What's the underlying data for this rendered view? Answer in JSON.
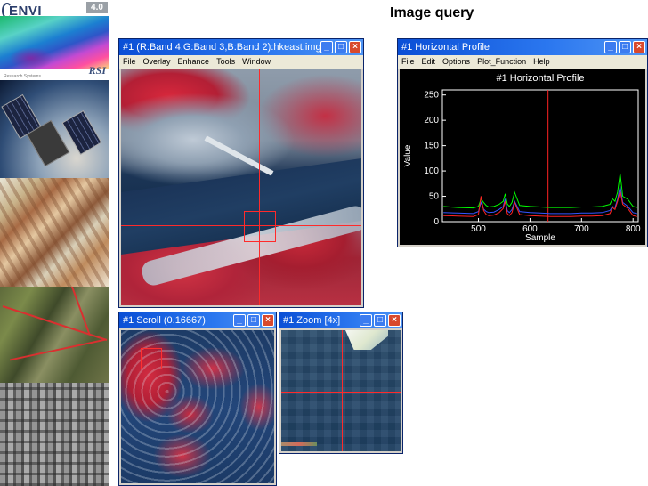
{
  "brand": {
    "logo_text": "ENVI",
    "version": "4.0",
    "company": "RSI",
    "tagline": "Research Systems"
  },
  "page": {
    "heading": "Image query"
  },
  "image_window": {
    "title": "#1 (R:Band 4,G:Band 3,B:Band 2):hkeast.img",
    "menu": [
      "File",
      "Overlay",
      "Enhance",
      "Tools",
      "Window"
    ]
  },
  "profile_window": {
    "title": "#1 Horizontal Profile",
    "menu": [
      "File",
      "Edit",
      "Options",
      "Plot_Function",
      "Help"
    ]
  },
  "scroll_window": {
    "title": "#1 Scroll (0.16667)"
  },
  "zoom_window": {
    "title": "#1 Zoom [4x]"
  },
  "window_buttons": {
    "minimize": "_",
    "maximize": "□",
    "close": "×"
  },
  "chart_data": {
    "type": "line",
    "title": "#1  Horizontal  Profile",
    "xlabel": "Sample",
    "ylabel": "Value",
    "xlim": [
      430,
      810
    ],
    "ylim": [
      0,
      260
    ],
    "x_ticks": [
      500,
      600,
      700,
      800
    ],
    "y_ticks": [
      0,
      50,
      100,
      150,
      200,
      250
    ],
    "cursor_x": 635,
    "series": [
      {
        "color": "#00ff00",
        "x": [
          432,
          460,
          490,
          500,
          505,
          510,
          515,
          520,
          530,
          540,
          548,
          552,
          556,
          560,
          565,
          570,
          580,
          600,
          620,
          640,
          660,
          680,
          700,
          720,
          740,
          755,
          760,
          765,
          770,
          775,
          780,
          790,
          800,
          808
        ],
        "y": [
          30,
          28,
          27,
          30,
          45,
          38,
          32,
          29,
          30,
          34,
          40,
          55,
          35,
          30,
          38,
          58,
          32,
          30,
          29,
          28,
          28,
          28,
          29,
          29,
          30,
          34,
          45,
          40,
          58,
          95,
          50,
          44,
          30,
          28
        ]
      },
      {
        "color": "#3355ff",
        "x": [
          432,
          460,
          490,
          500,
          505,
          510,
          515,
          520,
          530,
          540,
          548,
          552,
          556,
          560,
          565,
          570,
          580,
          600,
          620,
          640,
          660,
          680,
          700,
          720,
          740,
          755,
          760,
          765,
          770,
          775,
          780,
          790,
          800,
          808
        ],
        "y": [
          18,
          17,
          16,
          20,
          38,
          25,
          20,
          18,
          19,
          24,
          30,
          45,
          22,
          18,
          24,
          40,
          20,
          18,
          17,
          16,
          16,
          16,
          17,
          17,
          18,
          22,
          30,
          28,
          44,
          70,
          38,
          30,
          18,
          16
        ]
      },
      {
        "color": "#ff2222",
        "x": [
          432,
          460,
          490,
          500,
          505,
          510,
          515,
          520,
          530,
          540,
          548,
          552,
          556,
          560,
          565,
          570,
          580,
          600,
          620,
          640,
          660,
          680,
          700,
          720,
          740,
          755,
          760,
          765,
          770,
          775,
          780,
          790,
          800,
          808
        ],
        "y": [
          12,
          11,
          10,
          14,
          50,
          22,
          14,
          12,
          13,
          18,
          26,
          40,
          16,
          12,
          18,
          38,
          14,
          12,
          11,
          10,
          10,
          10,
          11,
          11,
          12,
          16,
          28,
          24,
          40,
          60,
          34,
          26,
          12,
          10
        ]
      }
    ]
  }
}
